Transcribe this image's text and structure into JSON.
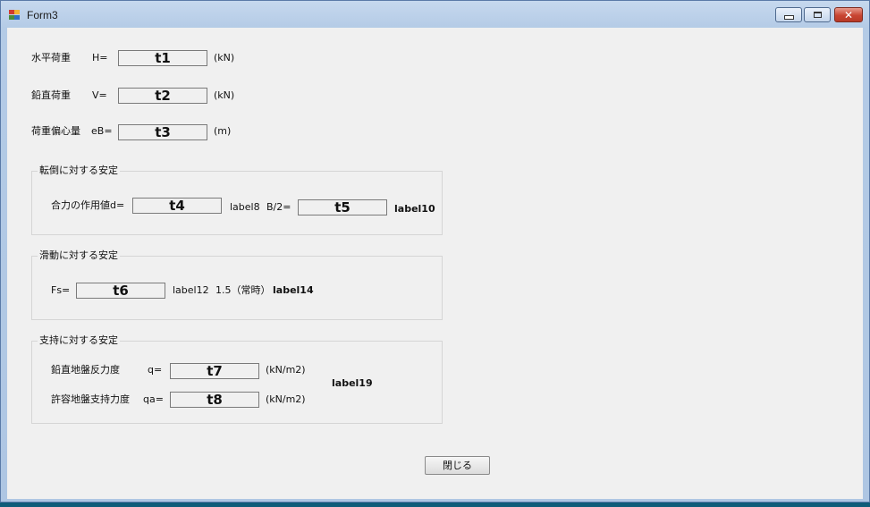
{
  "window": {
    "title": "Form3",
    "colors": {
      "client_bg": "#f0f0f0",
      "titlebar": "#b4cbe6",
      "close_button": "#c84532"
    }
  },
  "top": {
    "h_label": "水平荷重",
    "h_eq": "H=",
    "h_value": "t1",
    "h_unit": "(kN)",
    "v_label": "鉛直荷重",
    "v_eq": "V=",
    "v_value": "t2",
    "v_unit": "(kN)",
    "eb_label": "荷重偏心量",
    "eb_eq": "eB=",
    "eb_value": "t3",
    "eb_unit": "(m)"
  },
  "overturning": {
    "title": "転倒に対する安定",
    "d_label": "合力の作用値d=",
    "d_value": "t4",
    "label8": "label8",
    "b2_label": "B/2=",
    "b2_value": "t5",
    "label10": "label10"
  },
  "sliding": {
    "title": "滑動に対する安定",
    "fs_label": "Fs=",
    "fs_value": "t6",
    "label12": "label12",
    "criterion": "1.5（常時）",
    "label14": "label14"
  },
  "bearing": {
    "title": "支持に対する安定",
    "q_label": "鉛直地盤反力度",
    "q_eq": "q=",
    "q_value": "t7",
    "q_unit": "(kN/m2)",
    "qa_label": "許容地盤支持力度",
    "qa_eq": "qa=",
    "qa_value": "t8",
    "qa_unit": "(kN/m2)",
    "label19": "label19"
  },
  "close_button": "閉じる"
}
